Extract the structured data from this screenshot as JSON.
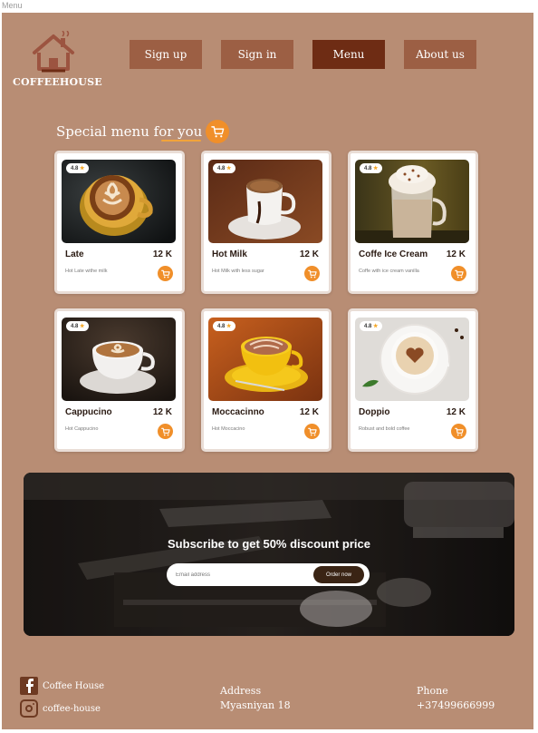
{
  "frame": {
    "label": "Menu"
  },
  "header": {
    "logo_text": "COFFEEHOUSE",
    "nav": [
      {
        "label": "Sign up",
        "active": false
      },
      {
        "label": "Sign in",
        "active": false
      },
      {
        "label": "Menu",
        "active": true
      },
      {
        "label": "About us",
        "active": false
      }
    ]
  },
  "section": {
    "title": "Special menu for you"
  },
  "products": [
    {
      "name": "Late",
      "price": "12 K",
      "description": "Hot Late withe milk",
      "rating": "4.8"
    },
    {
      "name": "Hot Milk",
      "price": "12 K",
      "description": "Hot Milk with less sugar",
      "rating": "4.8"
    },
    {
      "name": "Coffe Ice Cream",
      "price": "12 K",
      "description": "Coffe with ice cream vanilla",
      "rating": "4.8"
    },
    {
      "name": "Cappucino",
      "price": "12 K",
      "description": "Hot Cappucino",
      "rating": "4.8"
    },
    {
      "name": "Moccacinno",
      "price": "12 K",
      "description": "Hot Moccacino",
      "rating": "4.8"
    },
    {
      "name": "Doppio",
      "price": "12 K",
      "description": "Robust and bold coffee",
      "rating": "4.8"
    }
  ],
  "subscribe": {
    "title": "Subscribe to get 50% discount price",
    "email_placeholder": "Email address",
    "button_label": "Order now"
  },
  "footer": {
    "facebook": "Coffee House",
    "instagram": "coffee-house",
    "address_label": "Address",
    "address_value": "Myasniyan 18",
    "phone_label": "Phone",
    "phone_value": "+37499666999"
  },
  "colors": {
    "page_bg": "#b88d74",
    "nav_button": "#9c5f44",
    "nav_active": "#6e2c14",
    "accent_orange": "#f08f2a"
  }
}
